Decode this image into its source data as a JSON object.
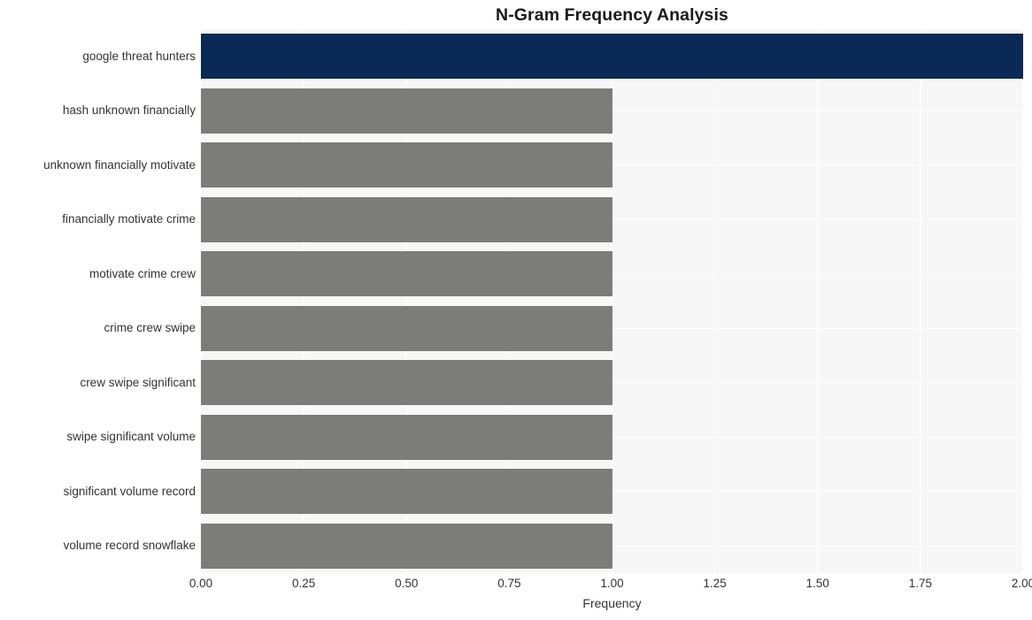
{
  "chart_data": {
    "type": "bar",
    "orientation": "horizontal",
    "title": "N-Gram Frequency Analysis",
    "xlabel": "Frequency",
    "ylabel": "",
    "categories": [
      "google threat hunters",
      "hash unknown financially",
      "unknown financially motivate",
      "financially motivate crime",
      "motivate crime crew",
      "crime crew swipe",
      "crew swipe significant",
      "swipe significant volume",
      "significant volume record",
      "volume record snowflake"
    ],
    "values": [
      2,
      1,
      1,
      1,
      1,
      1,
      1,
      1,
      1,
      1
    ],
    "bar_colors": [
      "#0a2a55",
      "#7c7c7a",
      "#7c7c7a",
      "#7c7c7a",
      "#7c7c7a",
      "#7c7c7a",
      "#7c7c7a",
      "#7c7c7a",
      "#7c7c7a",
      "#7c7c7a"
    ],
    "xlim": [
      0.0,
      2.0
    ],
    "xticks": [
      "0.00",
      "0.25",
      "0.50",
      "0.75",
      "1.00",
      "1.25",
      "1.50",
      "1.75",
      "2.00"
    ],
    "xtick_values": [
      0.0,
      0.25,
      0.5,
      0.75,
      1.0,
      1.25,
      1.5,
      1.75,
      2.0
    ],
    "grid": true,
    "legend": "none",
    "plot_background": "#f7f7f7",
    "grid_color": "#ffffff",
    "figure_background": "#ffffff",
    "highlight_color": "#0a2a55",
    "default_bar_color": "#7c7c7a"
  }
}
